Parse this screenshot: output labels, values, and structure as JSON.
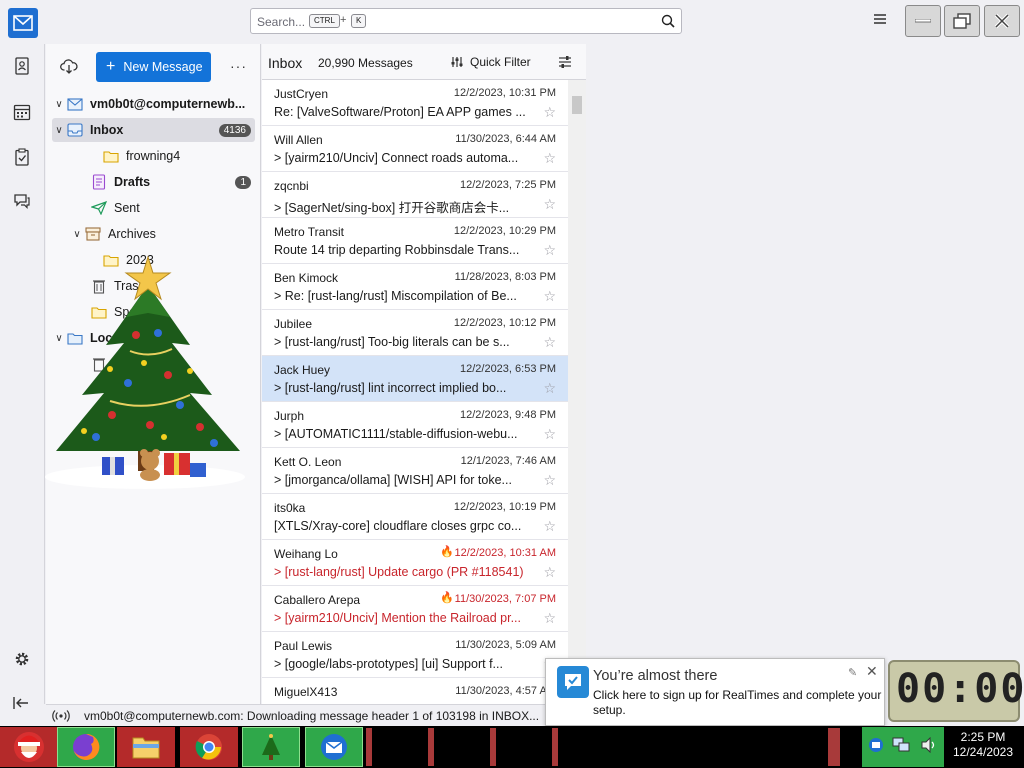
{
  "search": {
    "placeholder": "Search...",
    "key1": "CTRL",
    "plus": "+",
    "key2": "K"
  },
  "folders": {
    "new_message": "New Message",
    "more": "···",
    "account": "vm0b0t@computernewb...",
    "items": [
      {
        "label": "Inbox",
        "badge": "4136"
      },
      {
        "label": "frowning4"
      },
      {
        "label": "Drafts",
        "badge": "1"
      },
      {
        "label": "Sent"
      },
      {
        "label": "Archives"
      },
      {
        "label": "2023"
      },
      {
        "label": "Trash"
      },
      {
        "label": "Spa"
      },
      {
        "label": "Loca"
      }
    ]
  },
  "threads": {
    "title": "Inbox",
    "count": "20,990 Messages",
    "quick_filter": "Quick Filter",
    "messages": [
      {
        "from": "JustCryen",
        "date": "12/2/2023, 10:31 PM",
        "subject": "Re: [ValveSoftware/Proton] EA APP games ...",
        "thread": false
      },
      {
        "from": "Will Allen",
        "date": "11/30/2023, 6:44 AM",
        "subject": "[yairm210/Unciv] Connect roads automa...",
        "thread": true
      },
      {
        "from": "zqcnbi",
        "date": "12/2/2023, 7:25 PM",
        "subject": "[SagerNet/sing-box] 打开谷歌商店会卡...",
        "thread": true
      },
      {
        "from": "Metro Transit",
        "date": "12/2/2023, 10:29 PM",
        "subject": "Route 14 trip departing Robbinsdale Trans...",
        "thread": false
      },
      {
        "from": "Ben Kimock",
        "date": "11/28/2023, 8:03 PM",
        "subject": "Re: [rust-lang/rust] Miscompilation of Be...",
        "thread": true
      },
      {
        "from": "Jubilee",
        "date": "12/2/2023, 10:12 PM",
        "subject": "[rust-lang/rust] Too-big literals can be s...",
        "thread": true
      },
      {
        "from": "Jack Huey",
        "date": "12/2/2023, 6:53 PM",
        "subject": "[rust-lang/rust] lint incorrect implied bo...",
        "thread": true
      },
      {
        "from": "Jurph",
        "date": "12/2/2023, 9:48 PM",
        "subject": "[AUTOMATIC1111/stable-diffusion-webu...",
        "thread": true
      },
      {
        "from": "Kett O. Leon",
        "date": "12/1/2023, 7:46 AM",
        "subject": "[jmorganca/ollama] [WISH] API for toke...",
        "thread": true
      },
      {
        "from": "its0ka",
        "date": "12/2/2023, 10:19 PM",
        "subject": "[XTLS/Xray-core] cloudflare closes grpc co...",
        "thread": false
      },
      {
        "from": "Weihang Lo",
        "date": "12/2/2023, 10:31 AM",
        "subject": "[rust-lang/rust] Update cargo (PR #118541)",
        "thread": true
      },
      {
        "from": "Caballero Arepa",
        "date": "11/30/2023, 7:07 PM",
        "subject": "[yairm210/Unciv] Mention the Railroad pr...",
        "thread": true
      },
      {
        "from": "Paul Lewis",
        "date": "11/30/2023, 5:09 AM",
        "subject": "[google/labs-prototypes] [ui] Support f...",
        "thread": true
      },
      {
        "from": "MiguelX413",
        "date": "11/30/2023, 4:57 AM",
        "subject": "",
        "thread": false
      }
    ]
  },
  "status": {
    "text": "vm0b0t@computernewb.com: Downloading message header 1 of 103198 in INBOX..."
  },
  "toast": {
    "title": "You’re almost there",
    "body": "Click here to sign up for RealTimes and complete your setup."
  },
  "clock_widget": "00:00",
  "taskbar": {
    "time": "2:25 PM",
    "date": "12/24/2023"
  },
  "colors": {
    "accent": "#1373d9",
    "selected_row": "#d3e3f8",
    "hot": "#c8252c",
    "taskbar_green": "#2fa84a"
  }
}
